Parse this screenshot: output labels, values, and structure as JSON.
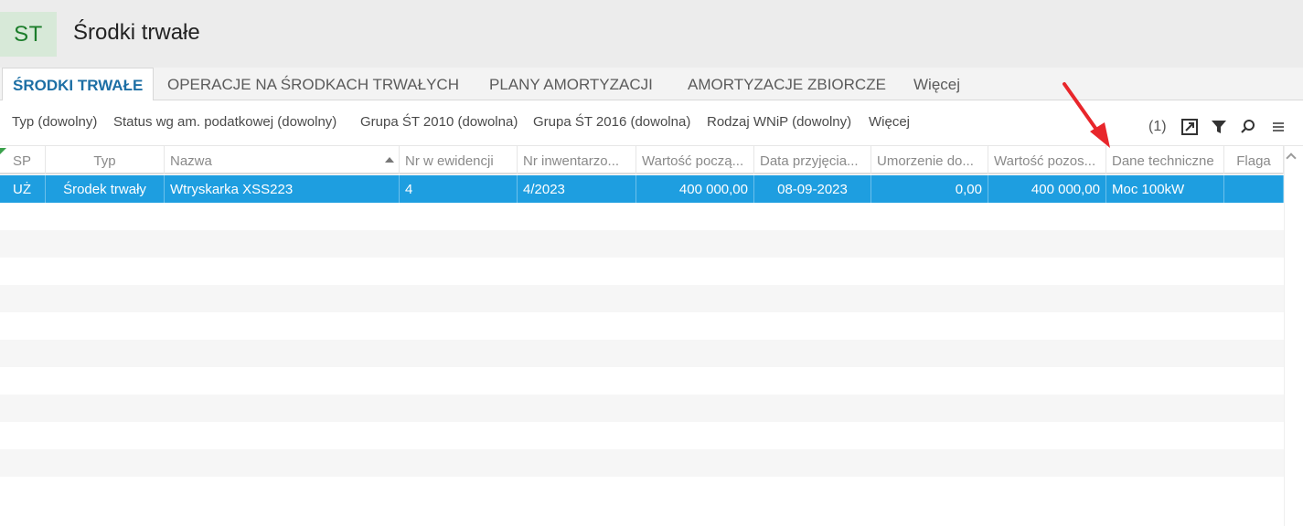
{
  "app": {
    "logo": "ST",
    "title": "Środki trwałe"
  },
  "tabs": [
    {
      "label": "ŚRODKI TRWAŁE",
      "active": true
    },
    {
      "label": "OPERACJE NA ŚRODKACH TRWAŁYCH"
    },
    {
      "label": "PLANY AMORTYZACJI"
    },
    {
      "label": "AMORTYZACJE ZBIORCZE"
    },
    {
      "label": "Więcej"
    }
  ],
  "filters": [
    {
      "label": "Typ (dowolny)"
    },
    {
      "label": "Status wg am. podatkowej (dowolny)"
    },
    {
      "label": "Grupa ŚT 2010 (dowolna)"
    },
    {
      "label": "Grupa ŚT 2016 (dowolna)"
    },
    {
      "label": "Rodzaj WNiP (dowolny)"
    },
    {
      "label": "Więcej"
    }
  ],
  "toolbar": {
    "count": "(1)",
    "icons": [
      "export-icon",
      "filter-icon",
      "search-icon",
      "menu-icon"
    ]
  },
  "grid": {
    "columns": [
      "SP",
      "Typ",
      "Nazwa",
      "Nr w ewidencji",
      "Nr inwentarzo...",
      "Wartość począ...",
      "Data przyjęcia...",
      "Umorzenie do...",
      "Wartość pozos...",
      "Dane techniczne",
      "Flaga"
    ],
    "sorted_column": "Nazwa",
    "sort_direction": "ascending",
    "rows": [
      {
        "sp": "UŻ",
        "typ": "Środek trwały",
        "nazwa": "Wtryskarka XSS223",
        "nr_ewidencji": "4",
        "nr_inwentarzowy": "4/2023",
        "wartosc_poczatkowa": "400 000,00",
        "data_przyjecia": "08-09-2023",
        "umorzenie": "0,00",
        "wartosc_pozostala": "400 000,00",
        "dane_techniczne": "Moc 100kW",
        "flaga": "",
        "selected": true
      }
    ]
  },
  "colors": {
    "selection": "#1e9ee0",
    "active_tab": "#1d6fa5",
    "logo_bg": "#d7e9d8",
    "logo_text": "#1b7d2a",
    "annotation": "#e8262b"
  }
}
